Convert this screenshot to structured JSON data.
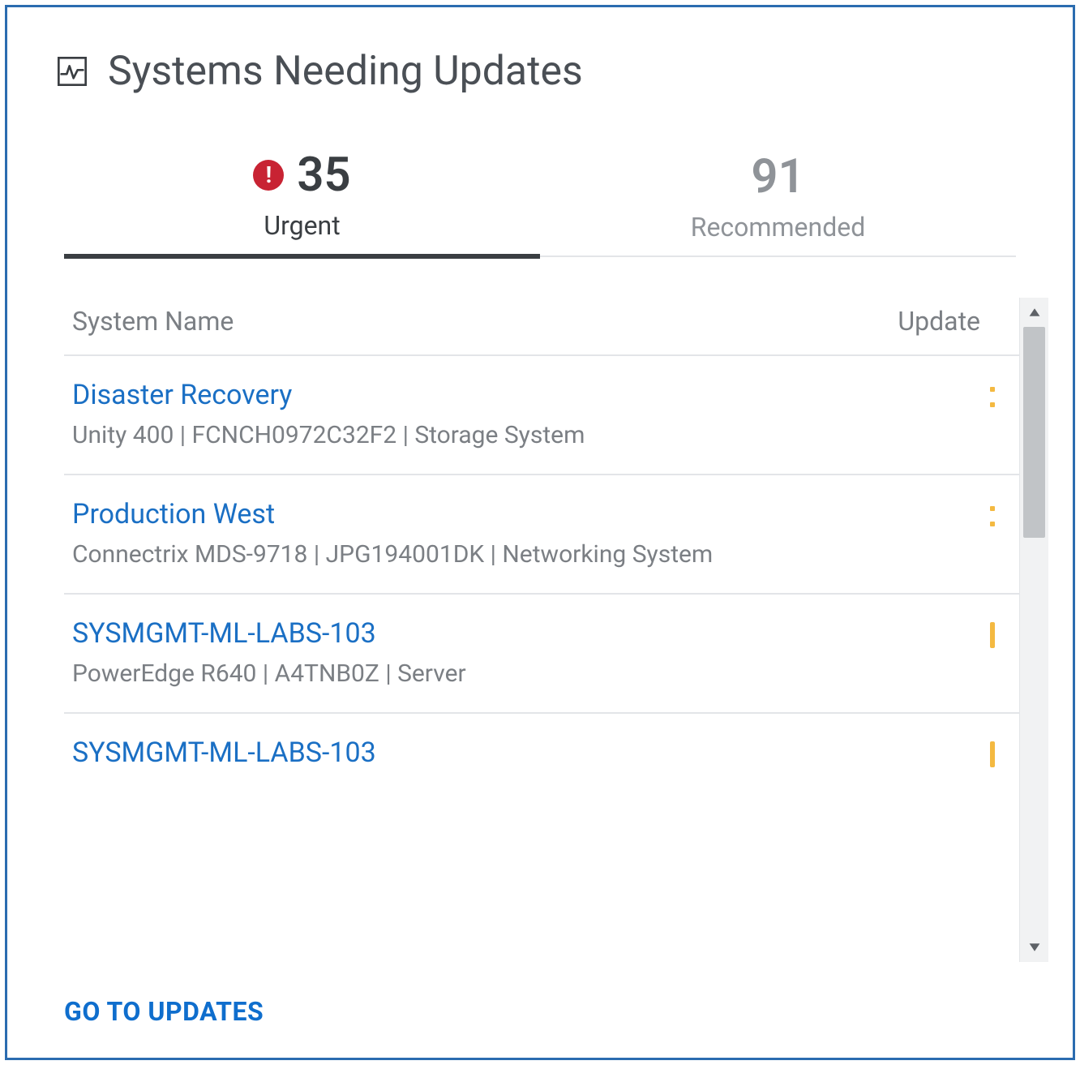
{
  "header": {
    "title": "Systems Needing Updates"
  },
  "tabs": {
    "urgent": {
      "count": "35",
      "label": "Urgent",
      "active": true
    },
    "recommended": {
      "count": "91",
      "label": "Recommended",
      "active": false
    }
  },
  "columns": {
    "name": "System Name",
    "update": "Update"
  },
  "rows": [
    {
      "title": "Disaster Recovery",
      "sub": "Unity 400 | FCNCH0972C32F2 | Storage System",
      "marker": "dots"
    },
    {
      "title": "Production West",
      "sub": "Connectrix MDS-9718 | JPG194001DK | Networking System",
      "marker": "dots"
    },
    {
      "title": "SYSMGMT-ML-LABS-103",
      "sub": "PowerEdge R640 | A4TNB0Z | Server",
      "marker": "bar"
    },
    {
      "title": "SYSMGMT-ML-LABS-103",
      "sub": "",
      "marker": "bar"
    }
  ],
  "footer": {
    "go_link": "GO TO UPDATES"
  }
}
